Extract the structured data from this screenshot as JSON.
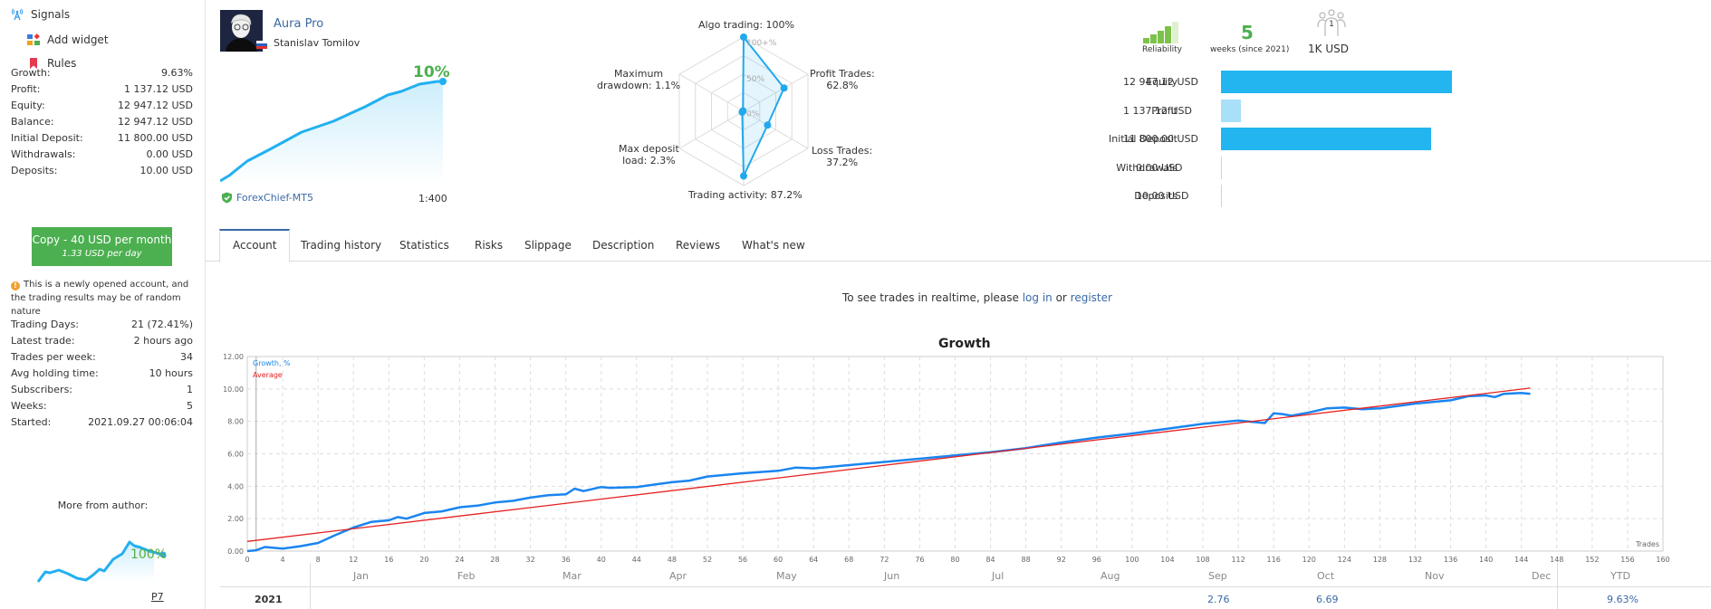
{
  "sidebar": {
    "nav": [
      {
        "label": "Signals",
        "icon": "signal-tower-icon"
      },
      {
        "label": "Add widget",
        "icon": "widget-icon"
      },
      {
        "label": "Rules",
        "icon": "bookmark-icon"
      }
    ],
    "stats": [
      {
        "label": "Growth:",
        "value": "9.63%"
      },
      {
        "label": "Profit:",
        "value": "1 137.12 USD"
      },
      {
        "label": "Equity:",
        "value": "12 947.12 USD"
      },
      {
        "label": "Balance:",
        "value": "12 947.12 USD"
      },
      {
        "label": "Initial Deposit:",
        "value": "11 800.00 USD"
      },
      {
        "label": "Withdrawals:",
        "value": "0.00 USD"
      },
      {
        "label": "Deposits:",
        "value": "10.00 USD"
      }
    ],
    "copy_button": {
      "label": "Copy - 40 USD per month",
      "sublabel": "1.33 USD per day"
    },
    "notice": "This is a newly opened account, and the trading results may be of random nature",
    "stats2": [
      {
        "label": "Trading Days:",
        "value": "21 (72.41%)"
      },
      {
        "label": "Latest trade:",
        "value": "2 hours ago"
      },
      {
        "label": "Trades per week:",
        "value": "34"
      },
      {
        "label": "Avg holding time:",
        "value": "10 hours"
      },
      {
        "label": "Subscribers:",
        "value": "1"
      },
      {
        "label": "Weeks:",
        "value": "5"
      },
      {
        "label": "Started:",
        "value": "2021.09.27 00:06:04"
      }
    ],
    "more_from_author": {
      "title": "More from author:",
      "growth_pct": "100%",
      "signal_link": "P7"
    }
  },
  "header": {
    "signal_name": "Aura Pro",
    "author": "Stanislav Tomilov",
    "growth_pct": "10%",
    "broker": "ForexChief-MT5",
    "leverage": "1:400"
  },
  "radar": {
    "labels": {
      "algo": "Algo trading: 100%",
      "profit": [
        "Profit Trades:",
        "62.8%"
      ],
      "loss": [
        "Loss Trades:",
        "37.2%"
      ],
      "activity": "Trading activity: 87.2%",
      "deposit_load": [
        "Max deposit",
        "load: 2.3%"
      ],
      "drawdown": [
        "Maximum",
        "drawdown: 1.1%"
      ]
    },
    "scale": {
      "top": "100+%",
      "mid": "50%",
      "zero": "0%"
    },
    "values": {
      "algo": 100,
      "profit": 62.8,
      "loss": 37.2,
      "activity": 87.2,
      "deposit_load": 2.3,
      "drawdown": 1.1
    }
  },
  "summary": {
    "reliability_label": "Reliability",
    "reliability_level": 4,
    "reliability_max": 5,
    "weeks": "5",
    "weeks_label": "weeks (since 2021)",
    "subscribers_count": "1",
    "subscribers_funds": "1K USD"
  },
  "balances": [
    {
      "label": "Equity",
      "value": "12 947.12 USD",
      "amount": 12947.12
    },
    {
      "label": "Profit",
      "value": "1 137.12 USD",
      "amount": 1137.12
    },
    {
      "label": "Initial Deposit",
      "value": "11 800.00 USD",
      "amount": 11800.0
    },
    {
      "label": "Withdrawals",
      "value": "0.00 USD",
      "amount": 0
    },
    {
      "label": "Deposits",
      "value": "10.00 USD",
      "amount": 10
    }
  ],
  "tabs": [
    {
      "label": "Account",
      "active": true
    },
    {
      "label": "Trading history"
    },
    {
      "label": "Statistics"
    },
    {
      "label": "Risks"
    },
    {
      "label": "Slippage"
    },
    {
      "label": "Description"
    },
    {
      "label": "Reviews"
    },
    {
      "label": "What's new"
    }
  ],
  "realtime": {
    "prefix": "To see trades in realtime, please ",
    "login": "log in",
    "or": " or ",
    "register": "register"
  },
  "colors": {
    "accent_blue": "#3b6aa6",
    "green": "#4caf50",
    "bar_blue": "#22b5f0",
    "bar_light": "#a8e0fa",
    "growth_line": "#1a85f0",
    "average_line": "#e62020"
  },
  "chart_data": {
    "type": "line",
    "title": "Growth",
    "xlabel": "Trades",
    "ylabel": "",
    "xlim": [
      0,
      160
    ],
    "ylim": [
      0,
      12
    ],
    "x_ticks": [
      0,
      4,
      8,
      12,
      16,
      20,
      24,
      28,
      32,
      36,
      40,
      44,
      48,
      52,
      56,
      60,
      64,
      68,
      72,
      76,
      80,
      84,
      88,
      92,
      96,
      100,
      104,
      108,
      112,
      116,
      120,
      124,
      128,
      132,
      136,
      140,
      144,
      148,
      152,
      156,
      160
    ],
    "y_ticks": [
      "0.00",
      "2.00",
      "4.00",
      "6.00",
      "8.00",
      "10.00",
      "12.00"
    ],
    "legend": [
      "Growth, %",
      "Average"
    ],
    "legend_position": "top-left",
    "grid": true,
    "series": [
      {
        "name": "Growth, %",
        "x": [
          0,
          1,
          2,
          4,
          6,
          8,
          10,
          12,
          14,
          16,
          17,
          18,
          20,
          22,
          24,
          26,
          28,
          30,
          32,
          34,
          36,
          37,
          38,
          40,
          41,
          44,
          46,
          48,
          50,
          52,
          56,
          60,
          62,
          64,
          68,
          72,
          76,
          80,
          84,
          88,
          92,
          96,
          100,
          104,
          108,
          112,
          115,
          116,
          117,
          118,
          120,
          122,
          124,
          126,
          128,
          132,
          136,
          138,
          140,
          141,
          142,
          144,
          145
        ],
        "y": [
          0.0,
          0.05,
          0.25,
          0.15,
          0.3,
          0.5,
          1.0,
          1.45,
          1.8,
          1.9,
          2.1,
          2.0,
          2.35,
          2.45,
          2.7,
          2.8,
          3.0,
          3.1,
          3.3,
          3.45,
          3.5,
          3.85,
          3.7,
          3.95,
          3.9,
          3.95,
          4.1,
          4.25,
          4.35,
          4.6,
          4.8,
          4.95,
          5.15,
          5.1,
          5.3,
          5.5,
          5.7,
          5.9,
          6.1,
          6.35,
          6.7,
          7.0,
          7.25,
          7.55,
          7.85,
          8.05,
          7.9,
          8.5,
          8.45,
          8.35,
          8.55,
          8.8,
          8.85,
          8.75,
          8.8,
          9.1,
          9.3,
          9.55,
          9.6,
          9.5,
          9.7,
          9.75,
          9.7
        ]
      },
      {
        "name": "Average",
        "x": [
          0,
          145
        ],
        "y": [
          0.6,
          10.05
        ]
      }
    ]
  },
  "monthly": {
    "year": "2021",
    "months": [
      "Jan",
      "Feb",
      "Mar",
      "Apr",
      "May",
      "Jun",
      "Jul",
      "Aug",
      "Sep",
      "Oct",
      "Nov",
      "Dec"
    ],
    "values": {
      "Sep": "2.76",
      "Oct": "6.69"
    },
    "ytd_label": "YTD",
    "ytd_value": "9.63%"
  }
}
